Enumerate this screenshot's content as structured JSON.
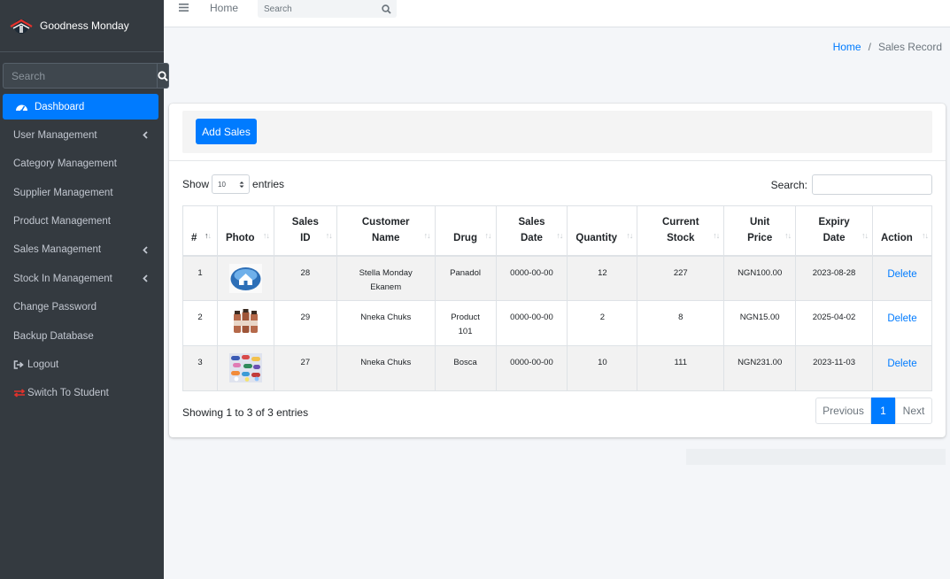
{
  "brand": {
    "name": "Goodness Monday"
  },
  "sidebar": {
    "search_placeholder": "Search",
    "items": [
      {
        "label": "Dashboard",
        "icon": "tachometer-icon",
        "active": true
      },
      {
        "label": "User Management",
        "icon": "chevron-left-icon"
      },
      {
        "label": "Category Management"
      },
      {
        "label": "Supplier Management"
      },
      {
        "label": "Product Management"
      },
      {
        "label": "Sales Management",
        "icon": "chevron-left-icon"
      },
      {
        "label": "Stock In Management",
        "icon": "chevron-left-icon"
      },
      {
        "label": "Change Password"
      },
      {
        "label": "Backup Database"
      },
      {
        "label": "Logout",
        "icon": "sign-out-icon"
      },
      {
        "label": "Switch To Student",
        "icon": "exchange-icon"
      }
    ]
  },
  "topbar": {
    "home": "Home",
    "search_placeholder": "Search"
  },
  "breadcrumb": {
    "home": "Home",
    "separator": "/",
    "current": "Sales Record"
  },
  "card": {
    "add_button": "Add Sales",
    "show_label": "Show",
    "entries_value": "10",
    "entries_label": "entries",
    "search_label": "Search:"
  },
  "table": {
    "columns": [
      {
        "line1": "#",
        "line2": ""
      },
      {
        "line1": "Photo",
        "line2": ""
      },
      {
        "line1": "Sales",
        "line2": "ID"
      },
      {
        "line1": "Customer",
        "line2": "Name"
      },
      {
        "line1": "Drug",
        "line2": ""
      },
      {
        "line1": "Sales",
        "line2": "Date"
      },
      {
        "line1": "Quantity",
        "line2": ""
      },
      {
        "line1": "Current",
        "line2": "Stock"
      },
      {
        "line1": "Unit",
        "line2": "Price"
      },
      {
        "line1": "Expiry",
        "line2": "Date"
      },
      {
        "line1": "Action",
        "line2": ""
      }
    ],
    "rows": [
      {
        "num": "1",
        "sales_id": "28",
        "customer_l1": "Stella Monday",
        "customer_l2": "Ekanem",
        "drug_l1": "Panadol",
        "drug_l2": "",
        "sales_date": "0000-00-00",
        "quantity": "12",
        "stock": "227",
        "price": "NGN100.00",
        "expiry": "2023-08-28",
        "action": "Delete",
        "photo": "home-icon-thumbnail"
      },
      {
        "num": "2",
        "sales_id": "29",
        "customer_l1": "Nneka Chuks",
        "customer_l2": "",
        "drug_l1": "Product",
        "drug_l2": "101",
        "sales_date": "0000-00-00",
        "quantity": "2",
        "stock": "8",
        "price": "NGN15.00",
        "expiry": "2025-04-02",
        "action": "Delete",
        "photo": "bottles-thumbnail"
      },
      {
        "num": "3",
        "sales_id": "27",
        "customer_l1": "Nneka Chuks",
        "customer_l2": "",
        "drug_l1": "Bosca",
        "drug_l2": "",
        "sales_date": "0000-00-00",
        "quantity": "10",
        "stock": "111",
        "price": "NGN231.00",
        "expiry": "2023-11-03",
        "action": "Delete",
        "photo": "pills-thumbnail"
      }
    ]
  },
  "footer": {
    "info": "Showing 1 to 3 of 3 entries",
    "prev": "Previous",
    "page": "1",
    "next": "Next"
  },
  "colors": {
    "primary": "#007bff",
    "sidebar_bg": "#343a40",
    "switch_icon": "#e4312b"
  }
}
